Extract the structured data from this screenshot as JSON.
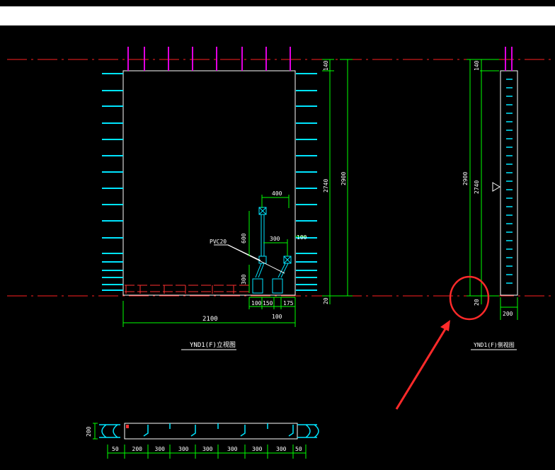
{
  "elevation_view": {
    "dims_vertical": [
      "140",
      "2740",
      "2900"
    ],
    "dims_bottom": [
      "100",
      "150",
      "175",
      "100"
    ],
    "dims_pipe": [
      "400",
      "300",
      "600",
      "300",
      "100"
    ],
    "overall_width": "2100",
    "bottom_level": "20",
    "pipe_label": "PVC20",
    "caption": "YND1(F)立视图"
  },
  "side_view": {
    "dims_vertical": [
      "140",
      "2740",
      "2900"
    ],
    "bottom_level": "20",
    "width": "200",
    "caption": "YND1(F)侧视图"
  },
  "plan_view": {
    "depth": "200",
    "segments": [
      "50",
      "200",
      "300",
      "300",
      "300",
      "300",
      "300",
      "300",
      "50"
    ]
  },
  "colors": {
    "background": "#000000",
    "rebar_top": "#e000e0",
    "ticks": "#00e5ff",
    "dimension": "#00ff00",
    "axis": "#ff2020",
    "annotation_arrow": "#ff2a2a"
  }
}
